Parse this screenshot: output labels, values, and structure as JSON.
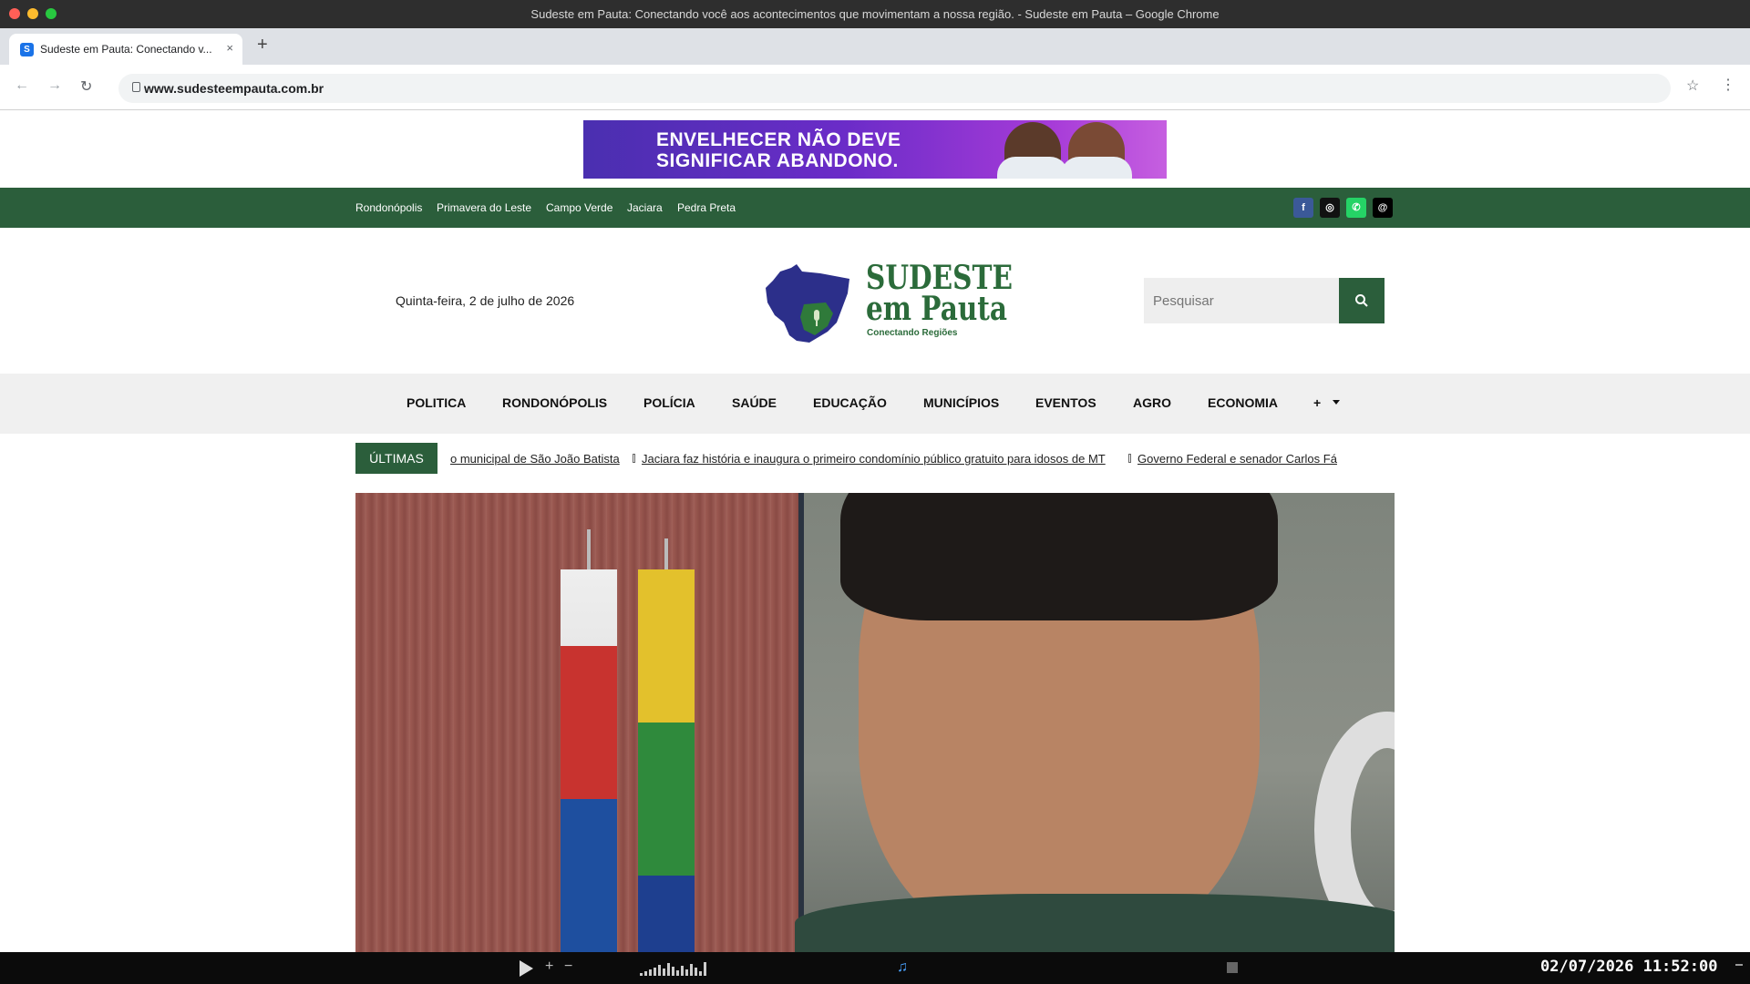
{
  "window": {
    "title": "Sudeste em Pauta: Conectando você aos acontecimentos que movimentam a nossa região. - Sudeste em Pauta – Google Chrome"
  },
  "tab": {
    "favicon_letter": "S",
    "title": "Sudeste em Pauta: Conectando v...",
    "close": "×"
  },
  "new_tab": "+",
  "address_bar": {
    "url": "www.sudesteempauta.com.br"
  },
  "ad_banner": {
    "line1": "ENVELHECER NÃO DEVE",
    "line2": "SIGNIFICAR ABANDONO."
  },
  "top_bar": {
    "cities": [
      "Rondonópolis",
      "Primavera do Leste",
      "Campo Verde",
      "Jaciara",
      "Pedra Preta"
    ],
    "social_icons": [
      "facebook-icon",
      "instagram-icon",
      "whatsapp-icon",
      "threads-icon"
    ]
  },
  "header": {
    "date": "Quinta-feira, 2 de julho de 2026",
    "logo_line1": "SUDESTE",
    "logo_line2": "em Pauta",
    "logo_tagline": "Conectando Regiões",
    "search_placeholder": "Pesquisar"
  },
  "main_nav": {
    "items": [
      "POLITICA",
      "RONDONÓPOLIS",
      "POLÍCIA",
      "SAÚDE",
      "EDUCAÇÃO",
      "MUNICÍPIOS",
      "EVENTOS",
      "AGRO",
      "ECONOMIA",
      "+"
    ]
  },
  "ticker": {
    "label": "ÚLTIMAS",
    "items": [
      "o municipal de São João Batista",
      "Jaciara faz história e inaugura o primeiro condomínio público gratuito para idosos de MT",
      "Governo Federal e senador Carlos Fá"
    ]
  },
  "taskbar": {
    "clock": "02/07/2026 11:52:00",
    "plus": "+",
    "minus": "−"
  },
  "colors": {
    "brand_green": "#2b5e3b",
    "logo_green": "#2b6b3a",
    "map_blue": "#2c2f8a"
  }
}
